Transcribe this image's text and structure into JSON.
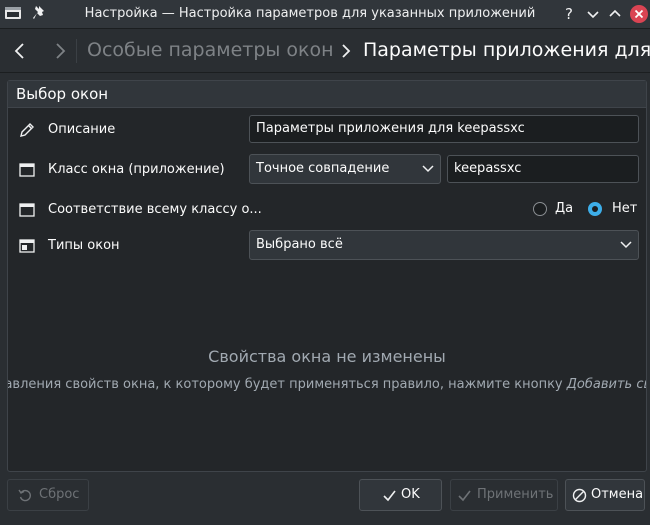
{
  "window": {
    "title": "Настройка — Настройка параметров для указанных приложений",
    "help_glyph": "?"
  },
  "breadcrumb": {
    "parent": "Особые параметры окон",
    "current": "Параметры приложения для"
  },
  "group": {
    "title": "Выбор окон"
  },
  "rows": {
    "description": {
      "label": "Описание",
      "value": "Параметры приложения для keepassxc"
    },
    "window_class": {
      "label": "Класс окна (приложение)",
      "match": "Точное совпадение",
      "value": "keepassxc"
    },
    "whole_class": {
      "label": "Соответствие всему классу о...",
      "yes_label": "Да",
      "no_label": "Нет",
      "selected": "no"
    },
    "window_types": {
      "label": "Типы окон",
      "value": "Выбрано всё"
    }
  },
  "empty_state": {
    "title": "Свойства окна не изменены",
    "hint": "добавления свойств окна, к которому будет применяться правило, нажмите кнопку",
    "hint_action": "Добавить свойс"
  },
  "buttons": {
    "reset": "Сброс",
    "ok": "OK",
    "apply": "Применить",
    "cancel": "Отмена"
  },
  "colors": {
    "accent": "#3daee9",
    "close": "#da4453",
    "background": "#2a2e32"
  }
}
